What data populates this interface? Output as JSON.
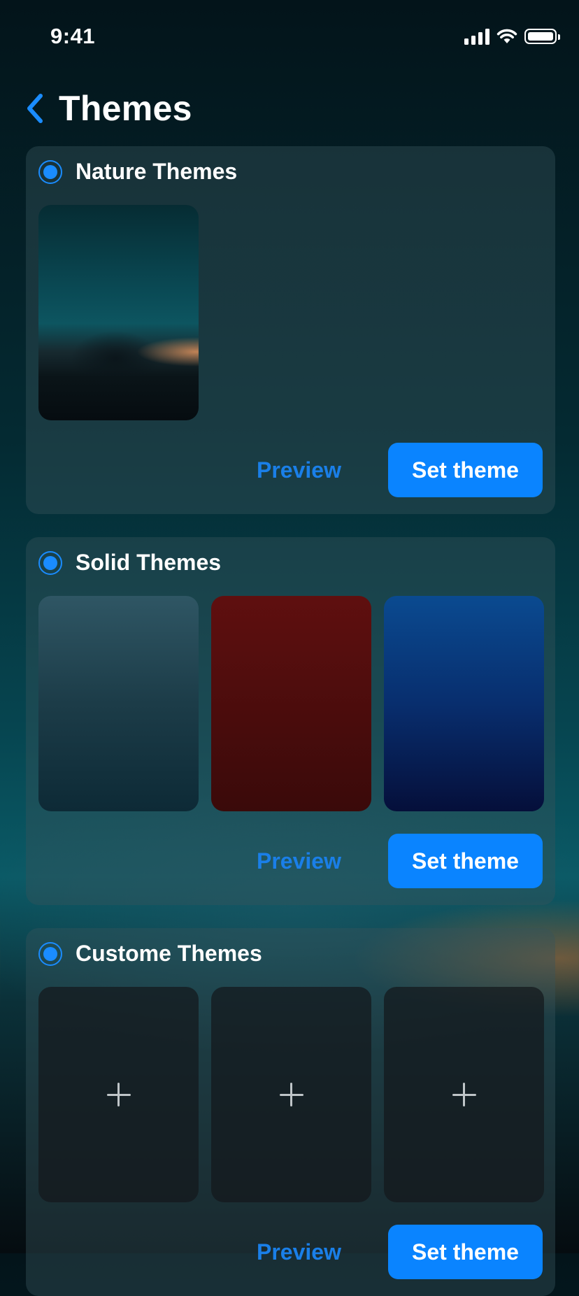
{
  "status_bar": {
    "time": "9:41",
    "icons": [
      "cellular-signal-icon",
      "wifi-icon",
      "battery-icon"
    ]
  },
  "header": {
    "back_icon": "chevron-left-icon",
    "title": "Themes"
  },
  "colors": {
    "accent": "#0a84ff",
    "link": "#1a7fe8"
  },
  "sections": [
    {
      "title": "Nature Themes",
      "selected": true,
      "thumbnails": [
        "nature-wallpaper"
      ],
      "preview_label": "Preview",
      "set_label": "Set theme"
    },
    {
      "title": "Solid Themes",
      "selected": true,
      "thumbnails": [
        "slate-teal",
        "dark-red",
        "deep-blue"
      ],
      "preview_label": "Preview",
      "set_label": "Set theme"
    },
    {
      "title": "Custome Themes",
      "selected": true,
      "thumbnails": [
        "empty-slot",
        "empty-slot",
        "empty-slot"
      ],
      "preview_label": "Preview",
      "set_label": "Set theme"
    }
  ]
}
